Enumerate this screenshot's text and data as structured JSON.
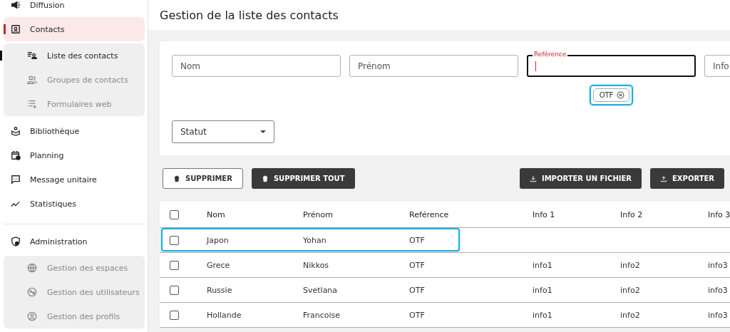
{
  "sidebar": {
    "sections": [
      {
        "items": [
          {
            "label": "Diffusion",
            "selected": false
          },
          {
            "label": "Contacts",
            "selected": true,
            "children": [
              {
                "label": "Liste des contacts",
                "selected": true
              },
              {
                "label": "Groupes de contacts",
                "selected": false
              },
              {
                "label": "Formulaires web",
                "selected": false
              }
            ]
          },
          {
            "label": "Bibliothèque",
            "selected": false
          },
          {
            "label": "Planning",
            "selected": false
          },
          {
            "label": "Message unitaire",
            "selected": false
          },
          {
            "label": "Statistiques",
            "selected": false
          }
        ]
      },
      {
        "items": [
          {
            "label": "Administration",
            "selected": false,
            "children": [
              {
                "label": "Gestion des espaces",
                "selected": false
              },
              {
                "label": "Gestion des utilisateurs",
                "selected": false
              },
              {
                "label": "Gestion des profils",
                "selected": false
              }
            ]
          }
        ]
      }
    ]
  },
  "page": {
    "title": "Gestion de la liste des contacts"
  },
  "filters": {
    "fields": [
      {
        "placeholder": "Nom",
        "focused": false
      },
      {
        "placeholder": "Prénom",
        "focused": false
      },
      {
        "label": "Reférence",
        "focused": true,
        "chips": [
          {
            "label": "OTF",
            "highlighted": true
          }
        ]
      },
      {
        "placeholder": "Info",
        "focused": false
      }
    ],
    "status": {
      "placeholder": "Statut"
    }
  },
  "actions": {
    "left": [
      {
        "label": "SUPPRIMER",
        "kind": "outlined"
      },
      {
        "label": "SUPPRIMER TOUT",
        "kind": "filled"
      }
    ],
    "right": [
      {
        "label": "IMPORTER UN FICHIER",
        "kind": "filled"
      },
      {
        "label": "EXPORTER",
        "kind": "filled"
      }
    ]
  },
  "table": {
    "select_all": {
      "checked": false
    },
    "columns": [
      "Nom",
      "Prénom",
      "Reférence",
      "Info 1",
      "Info 2",
      "Info 3"
    ],
    "rows": [
      {
        "checked": false,
        "highlighted": true,
        "cells": [
          "Japon",
          "Yohan",
          "OTF"
        ]
      },
      {
        "checked": false,
        "highlighted": false,
        "cells": [
          "Grece",
          "Nikkos",
          "OTF",
          "info1",
          "info2",
          "info3"
        ]
      },
      {
        "checked": false,
        "highlighted": false,
        "cells": [
          "Russie",
          "Svetlana",
          "OTF",
          "info1",
          "info2",
          "info3"
        ]
      },
      {
        "checked": false,
        "highlighted": false,
        "cells": [
          "Hollande",
          "Francoise",
          "OTF",
          "info1",
          "info2",
          "info3"
        ]
      }
    ]
  }
}
